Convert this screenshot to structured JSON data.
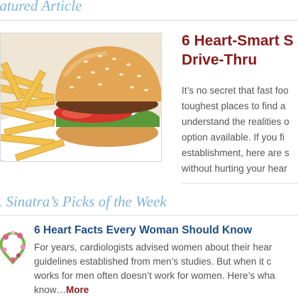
{
  "featured": {
    "section_title": "eatured Article",
    "headline": "6 Heart-Smart S Drive-Thru",
    "body_lines": [
      "It’s no secret that fast foo",
      "toughest places to find a",
      "understand the realities o",
      "option available. If you fi",
      "establishment, here are s",
      "without hurting your hear"
    ]
  },
  "picks": {
    "section_title": "r. Sinatra’s Picks of the Week",
    "items": [
      {
        "headline": "6 Heart Facts Every Woman Should Know",
        "body_lines": [
          "For years, cardiologists advised women about their hear",
          "guidelines established from men’s studies. But when it c",
          "works for men often doesn’t work for women. Here’s wha",
          "know…"
        ],
        "more_label": "More"
      }
    ]
  },
  "colors": {
    "section_title": "#7fb4d9",
    "featured_headline": "#8b1a1a",
    "pick_headline": "#1e4f86",
    "body_text": "#555555"
  }
}
